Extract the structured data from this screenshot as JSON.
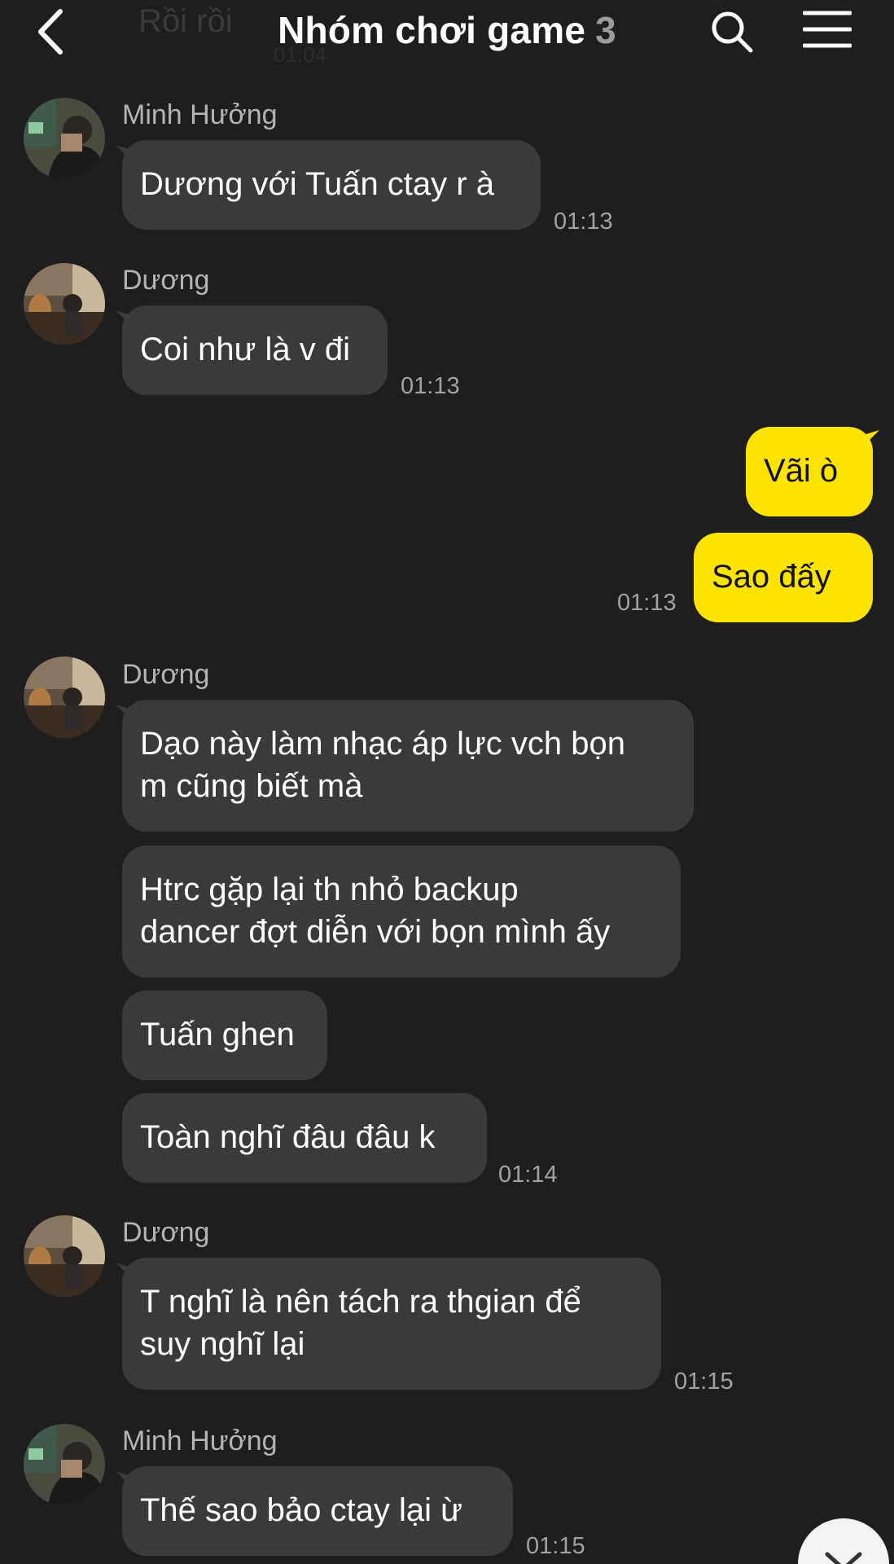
{
  "header": {
    "title": "Nhóm chơi game",
    "member_count": "3",
    "ghost_preview_text": "Rồi rồi",
    "ghost_preview_time": "01:04"
  },
  "messages": [
    {
      "sender": "Minh Hưởng",
      "text": "Dương với Tuấn ctay r à",
      "time": "01:13",
      "direction": "incoming"
    },
    {
      "sender": "Dương",
      "text": "Coi như là v đi",
      "time": "01:13",
      "direction": "incoming"
    },
    {
      "text": "Vãi ò",
      "direction": "outgoing"
    },
    {
      "text": "Sao đấy",
      "time": "01:13",
      "direction": "outgoing"
    },
    {
      "sender": "Dương",
      "lines": [
        "Dạo này làm nhạc áp lực vch bọn",
        "m cũng biết mà"
      ],
      "direction": "incoming"
    },
    {
      "lines": [
        "Htrc gặp lại th nhỏ backup",
        "dancer đợt diễn với bọn mình ấy"
      ],
      "direction": "incoming"
    },
    {
      "text": "Tuấn ghen",
      "direction": "incoming"
    },
    {
      "text": "Toàn nghĩ đâu đâu k",
      "time": "01:14",
      "direction": "incoming"
    },
    {
      "sender": "Dương",
      "lines": [
        "T nghĩ là nên tách ra thgian để",
        "suy nghĩ lại"
      ],
      "time": "01:15",
      "direction": "incoming"
    },
    {
      "sender": "Minh Hưởng",
      "text": "Thế sao bảo ctay lại ừ",
      "time": "01:15",
      "direction": "incoming"
    }
  ],
  "colors": {
    "background": "#1e1e1f",
    "incoming_bubble": "#3a3a3c",
    "outgoing_bubble": "#fde300"
  },
  "icons": [
    "back-chevron-icon",
    "search-icon",
    "menu-icon",
    "chevron-down-icon"
  ]
}
